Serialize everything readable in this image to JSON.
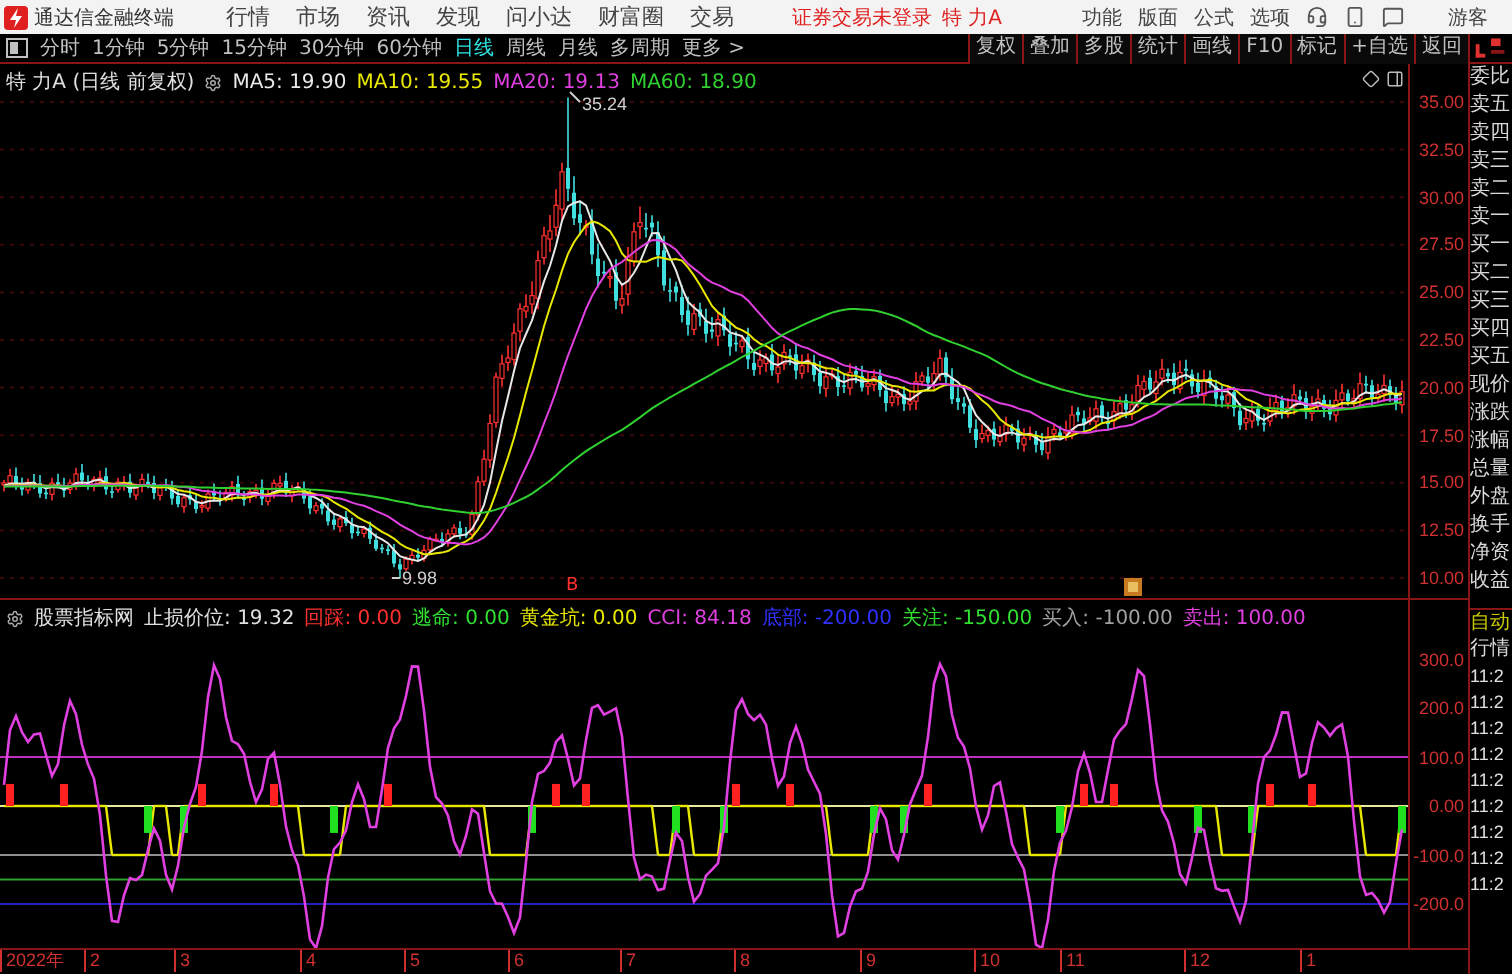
{
  "menubar": {
    "app_title": "通达信金融终端",
    "menus": [
      "行情",
      "市场",
      "资讯",
      "发现",
      "问小达",
      "财富圈",
      "交易"
    ],
    "login_status": "证券交易未登录",
    "stock": "特 力A",
    "tools": [
      "功能",
      "版面",
      "公式",
      "选项"
    ],
    "user": "游客"
  },
  "toolbar": {
    "periods": [
      {
        "label": "分时",
        "selected": false
      },
      {
        "label": "1分钟",
        "selected": false
      },
      {
        "label": "5分钟",
        "selected": false
      },
      {
        "label": "15分钟",
        "selected": false
      },
      {
        "label": "30分钟",
        "selected": false
      },
      {
        "label": "60分钟",
        "selected": false
      },
      {
        "label": "日线",
        "selected": true
      },
      {
        "label": "周线",
        "selected": false
      },
      {
        "label": "月线",
        "selected": false
      },
      {
        "label": "多周期",
        "selected": false
      },
      {
        "label": "更多 >",
        "selected": false
      }
    ],
    "actions": [
      "复权",
      "叠加",
      "多股",
      "统计",
      "画线",
      "F10",
      "标记",
      "+自选",
      "返回"
    ]
  },
  "main_chart": {
    "title": "特 力A (日线 前复权)",
    "averages": [
      {
        "label": "MA5: 19.90",
        "color": "#e8e8e8"
      },
      {
        "label": "MA10: 19.55",
        "color": "#e8e800"
      },
      {
        "label": "MA20: 19.13",
        "color": "#e040e0"
      },
      {
        "label": "MA60: 18.90",
        "color": "#30d030"
      }
    ],
    "high_label": "35.24",
    "low_label": "9.98",
    "signal_label": "B",
    "y_axis": [
      "35.00",
      "32.50",
      "30.00",
      "27.50",
      "25.00",
      "22.50",
      "20.00",
      "17.50",
      "15.00",
      "12.50",
      "10.00"
    ]
  },
  "indicator_chart": {
    "title": "股票指标网",
    "values": [
      {
        "label": "止损价位:",
        "value": "19.32",
        "color": "#e0e0e0"
      },
      {
        "label": "回踩:",
        "value": "0.00",
        "color": "#ff3030"
      },
      {
        "label": "逃命:",
        "value": "0.00",
        "color": "#30e030"
      },
      {
        "label": "黄金坑:",
        "value": "0.00",
        "color": "#e8e800"
      },
      {
        "label": "CCI:",
        "value": "84.18",
        "color": "#e040e0"
      },
      {
        "label": "底部:",
        "value": "-200.00",
        "color": "#3030ff"
      },
      {
        "label": "关注:",
        "value": "-150.00",
        "color": "#30e030"
      },
      {
        "label": "买入:",
        "value": "-100.00",
        "color": "#a0a0a0"
      },
      {
        "label": "卖出:",
        "value": "100.00",
        "color": "#e040e0"
      }
    ],
    "y_axis": [
      "300.0",
      "200.0",
      "100.0",
      "0.00",
      "-100.0",
      "-200.0"
    ]
  },
  "x_axis": [
    "2022年",
    "2",
    "3",
    "4",
    "5",
    "6",
    "7",
    "8",
    "9",
    "10",
    "11",
    "12",
    "1"
  ],
  "quote_panel": {
    "fields": [
      "委比",
      "卖五",
      "卖四",
      "卖三",
      "卖二",
      "卖一",
      "买一",
      "买二",
      "买三",
      "买四",
      "买五",
      "现价",
      "涨跌",
      "涨幅",
      "总量",
      "外盘",
      "换手",
      "净资",
      "收益"
    ],
    "mode": "自动",
    "tab": "行情",
    "times": [
      "11:2",
      "11:2",
      "11:2",
      "11:2",
      "11:2",
      "11:2",
      "11:2",
      "11:2",
      "11:2"
    ]
  }
}
